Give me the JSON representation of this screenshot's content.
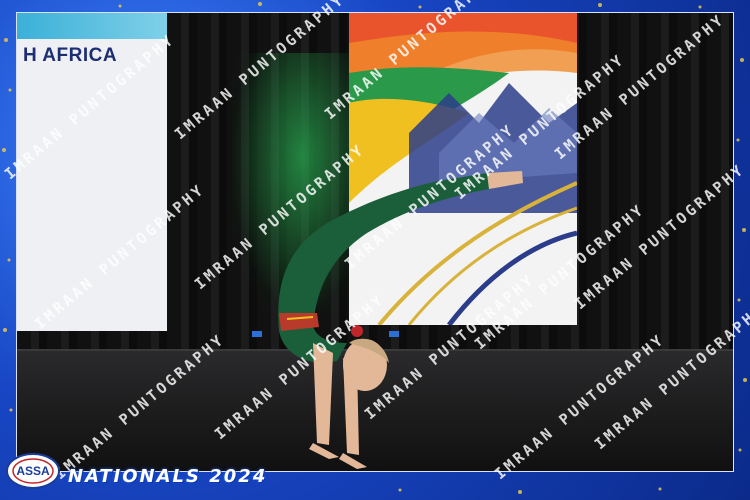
{
  "banner": {
    "left_text": "H AFRICA"
  },
  "footer": {
    "logo_text": "ASSA",
    "title": "NATIONALS 2024"
  },
  "watermark": {
    "text": "IMRAAN PUNTOGRAPHY"
  },
  "colors": {
    "frame_blue": "#1846c4",
    "costume_green": "#1b5e3a",
    "glitter_gold": "#e2c24a"
  }
}
